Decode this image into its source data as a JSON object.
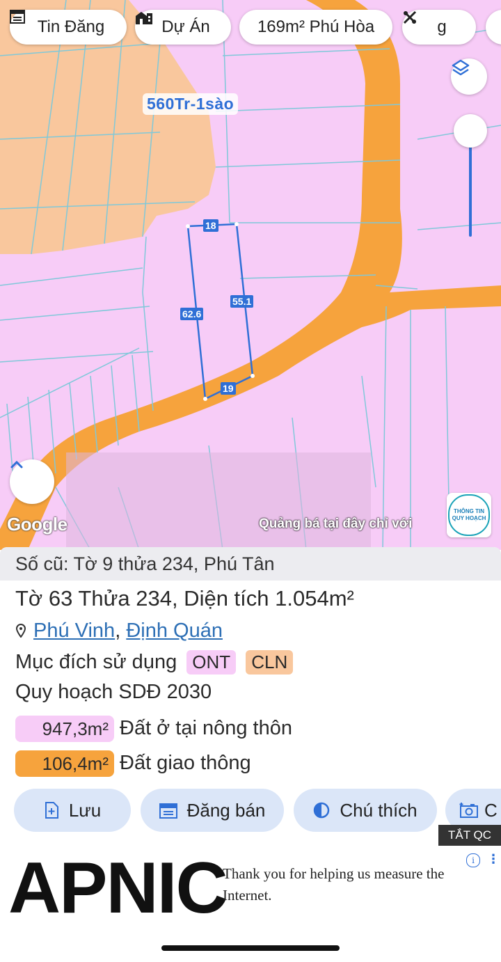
{
  "toolbar": {
    "chips": [
      {
        "label": "Tin Đăng",
        "icon": "listing-icon"
      },
      {
        "label": "Dự Án",
        "icon": "building-icon"
      },
      {
        "label": "169m² Phú Hòa",
        "icon": ""
      },
      {
        "label": "g",
        "icon": "tools-icon"
      }
    ]
  },
  "map": {
    "price_label": "560Tr-1sào",
    "parcel_dimensions": {
      "top": "18",
      "right": "55.1",
      "left": "62.6",
      "bottom": "19"
    },
    "attribution": "Google",
    "ad_banner_text": "Quảng bá tại đây chỉ với",
    "logo_text_top": "THÔNG TIN",
    "logo_text_bottom": "QUY HOẠCH",
    "colors": {
      "residential": "#f7ccf7",
      "agricultural": "#f9c79d",
      "road": "#f6a33d",
      "parcel_lines": "#7fc8d9",
      "selection": "#2f6fd6"
    }
  },
  "parcel": {
    "old_info": "Số cũ: Tờ 9 thửa 234, Phú Tân",
    "title_prefix": "Tờ 63 Thửa",
    "parcel_number": "234",
    "area_label": ", Diện tích",
    "area_value": "1.054m²",
    "commune": "Phú Vinh",
    "district": "Định Quán",
    "purpose_label": "Mục đích sử dụng",
    "purpose_tags": [
      "ONT",
      "CLN"
    ],
    "plan_label": "Quy hoạch SDĐ 2030",
    "plan_items": [
      {
        "area": "947,3m²",
        "desc": "Đất ở tại nông thôn",
        "color": "#f7ccf7"
      },
      {
        "area": "106,4m²",
        "desc": "Đất giao thông",
        "color": "#f6a33d"
      }
    ]
  },
  "actions": [
    {
      "label": "Lưu",
      "icon": "save-icon"
    },
    {
      "label": "Đăng bán",
      "icon": "calendar-icon"
    },
    {
      "label": "Chú thích",
      "icon": "legend-icon"
    },
    {
      "label": "C",
      "icon": "camera-icon"
    }
  ],
  "close_ad_label": "TẮT QC",
  "ad": {
    "brand": "APNIC",
    "text": "Thank you for helping us measure the Internet."
  }
}
